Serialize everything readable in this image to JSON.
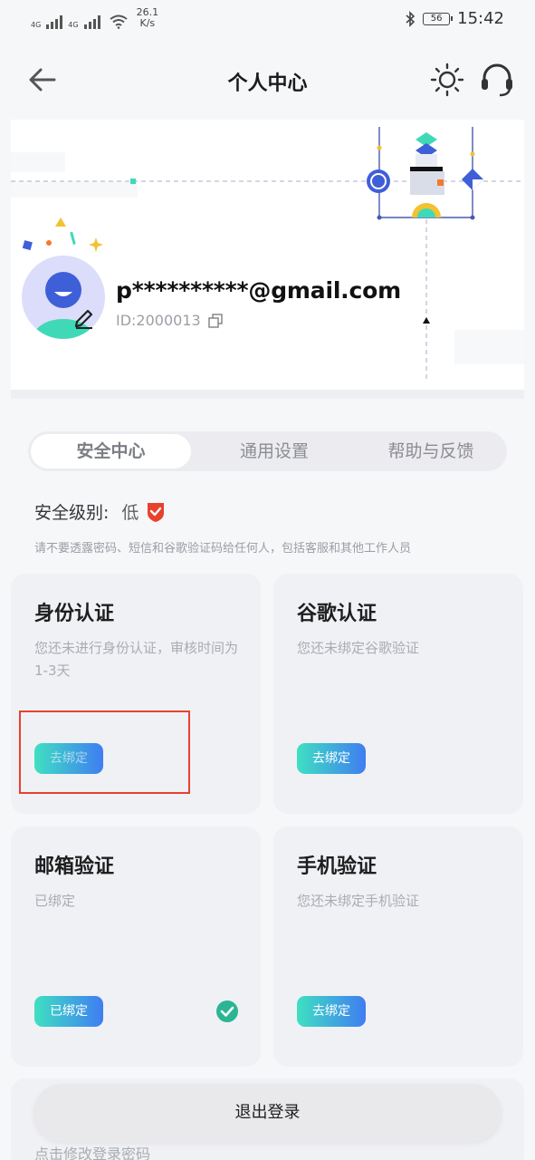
{
  "status_bar": {
    "network1": "4G",
    "network2": "4G",
    "speed_value": "26.1",
    "speed_unit": "K/s",
    "battery": "56",
    "time": "15:42"
  },
  "header": {
    "title": "个人中心"
  },
  "profile": {
    "email": "p**********@gmail.com",
    "user_id": "ID:2000013"
  },
  "tabs": [
    {
      "label": "安全中心",
      "active": true
    },
    {
      "label": "通用设置",
      "active": false
    },
    {
      "label": "帮助与反馈",
      "active": false
    }
  ],
  "security": {
    "level_label": "安全级别:",
    "level_value": "低",
    "warning": "请不要透露密码、短信和谷歌验证码给任何人，包括客服和其他工作人员"
  },
  "cards": {
    "identity": {
      "title": "身份认证",
      "desc": "您还未进行身份认证，审核时间为1-3天",
      "button": "去绑定"
    },
    "google": {
      "title": "谷歌认证",
      "desc": "您还未绑定谷歌验证",
      "button": "去绑定"
    },
    "email": {
      "title": "邮箱验证",
      "desc": "已绑定",
      "button": "已绑定"
    },
    "phone": {
      "title": "手机验证",
      "desc": "您还未绑定手机验证",
      "button": "去绑定"
    }
  },
  "bottom": {
    "logout": "退出登录",
    "change_password_hint": "点击修改登录密码"
  },
  "colors": {
    "accent_gradient_start": "#3fe0c2",
    "accent_gradient_end": "#3f7df2",
    "shield_red": "#e8412e",
    "check_green": "#2bb594",
    "highlight_red": "#e8412e"
  },
  "icons": {
    "back": "arrow-left-icon",
    "theme": "sun-icon",
    "support": "headset-icon",
    "copy": "copy-icon",
    "edit": "pencil-icon",
    "shield": "shield-check-icon",
    "check": "check-circle-icon"
  }
}
